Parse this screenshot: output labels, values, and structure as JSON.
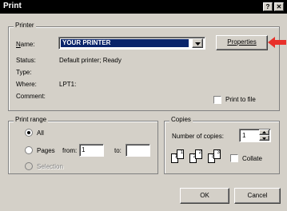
{
  "window": {
    "title": "Print",
    "help_button": "?",
    "close_button": "✕"
  },
  "printer": {
    "group_label": "Printer",
    "name_label": "Name:",
    "name_value": "YOUR PRINTER",
    "properties_label": "Properties",
    "status_label": "Status:",
    "status_value": "Default printer; Ready",
    "type_label": "Type:",
    "type_value": "",
    "where_label": "Where:",
    "where_value": "LPT1:",
    "comment_label": "Comment:",
    "comment_value": "",
    "print_to_file_label": "Print to file",
    "print_to_file_checked": false
  },
  "print_range": {
    "group_label": "Print range",
    "all_label": "All",
    "pages_label": "Pages",
    "from_label": "from:",
    "from_value": "1",
    "to_label": "to:",
    "to_value": "",
    "selection_label": "Selection",
    "selected": "all"
  },
  "copies": {
    "group_label": "Copies",
    "number_label": "Number of copies:",
    "number_value": "1",
    "collate_label": "Collate",
    "collate_checked": false,
    "collate_pages": [
      "1",
      "1",
      "2",
      "2",
      "3",
      "3"
    ]
  },
  "buttons": {
    "ok_label": "OK",
    "cancel_label": "Cancel"
  },
  "colors": {
    "dialog_bg": "#d4d0c8",
    "selection_bg": "#0a246a",
    "annotation_arrow": "#e8302a"
  }
}
